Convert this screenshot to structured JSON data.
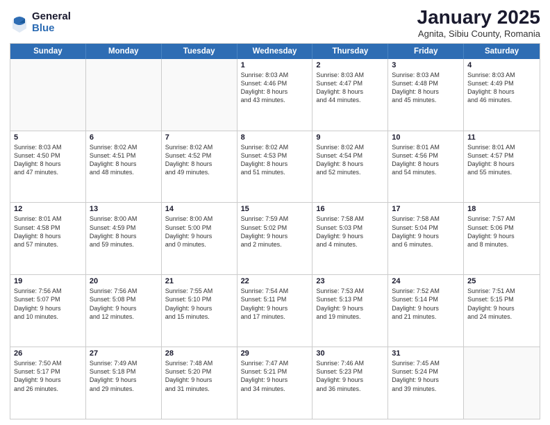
{
  "logo": {
    "general": "General",
    "blue": "Blue"
  },
  "title": "January 2025",
  "subtitle": "Agnita, Sibiu County, Romania",
  "days_of_week": [
    "Sunday",
    "Monday",
    "Tuesday",
    "Wednesday",
    "Thursday",
    "Friday",
    "Saturday"
  ],
  "weeks": [
    [
      {
        "day": "",
        "info": ""
      },
      {
        "day": "",
        "info": ""
      },
      {
        "day": "",
        "info": ""
      },
      {
        "day": "1",
        "info": "Sunrise: 8:03 AM\nSunset: 4:46 PM\nDaylight: 8 hours\nand 43 minutes."
      },
      {
        "day": "2",
        "info": "Sunrise: 8:03 AM\nSunset: 4:47 PM\nDaylight: 8 hours\nand 44 minutes."
      },
      {
        "day": "3",
        "info": "Sunrise: 8:03 AM\nSunset: 4:48 PM\nDaylight: 8 hours\nand 45 minutes."
      },
      {
        "day": "4",
        "info": "Sunrise: 8:03 AM\nSunset: 4:49 PM\nDaylight: 8 hours\nand 46 minutes."
      }
    ],
    [
      {
        "day": "5",
        "info": "Sunrise: 8:03 AM\nSunset: 4:50 PM\nDaylight: 8 hours\nand 47 minutes."
      },
      {
        "day": "6",
        "info": "Sunrise: 8:02 AM\nSunset: 4:51 PM\nDaylight: 8 hours\nand 48 minutes."
      },
      {
        "day": "7",
        "info": "Sunrise: 8:02 AM\nSunset: 4:52 PM\nDaylight: 8 hours\nand 49 minutes."
      },
      {
        "day": "8",
        "info": "Sunrise: 8:02 AM\nSunset: 4:53 PM\nDaylight: 8 hours\nand 51 minutes."
      },
      {
        "day": "9",
        "info": "Sunrise: 8:02 AM\nSunset: 4:54 PM\nDaylight: 8 hours\nand 52 minutes."
      },
      {
        "day": "10",
        "info": "Sunrise: 8:01 AM\nSunset: 4:56 PM\nDaylight: 8 hours\nand 54 minutes."
      },
      {
        "day": "11",
        "info": "Sunrise: 8:01 AM\nSunset: 4:57 PM\nDaylight: 8 hours\nand 55 minutes."
      }
    ],
    [
      {
        "day": "12",
        "info": "Sunrise: 8:01 AM\nSunset: 4:58 PM\nDaylight: 8 hours\nand 57 minutes."
      },
      {
        "day": "13",
        "info": "Sunrise: 8:00 AM\nSunset: 4:59 PM\nDaylight: 8 hours\nand 59 minutes."
      },
      {
        "day": "14",
        "info": "Sunrise: 8:00 AM\nSunset: 5:00 PM\nDaylight: 9 hours\nand 0 minutes."
      },
      {
        "day": "15",
        "info": "Sunrise: 7:59 AM\nSunset: 5:02 PM\nDaylight: 9 hours\nand 2 minutes."
      },
      {
        "day": "16",
        "info": "Sunrise: 7:58 AM\nSunset: 5:03 PM\nDaylight: 9 hours\nand 4 minutes."
      },
      {
        "day": "17",
        "info": "Sunrise: 7:58 AM\nSunset: 5:04 PM\nDaylight: 9 hours\nand 6 minutes."
      },
      {
        "day": "18",
        "info": "Sunrise: 7:57 AM\nSunset: 5:06 PM\nDaylight: 9 hours\nand 8 minutes."
      }
    ],
    [
      {
        "day": "19",
        "info": "Sunrise: 7:56 AM\nSunset: 5:07 PM\nDaylight: 9 hours\nand 10 minutes."
      },
      {
        "day": "20",
        "info": "Sunrise: 7:56 AM\nSunset: 5:08 PM\nDaylight: 9 hours\nand 12 minutes."
      },
      {
        "day": "21",
        "info": "Sunrise: 7:55 AM\nSunset: 5:10 PM\nDaylight: 9 hours\nand 15 minutes."
      },
      {
        "day": "22",
        "info": "Sunrise: 7:54 AM\nSunset: 5:11 PM\nDaylight: 9 hours\nand 17 minutes."
      },
      {
        "day": "23",
        "info": "Sunrise: 7:53 AM\nSunset: 5:13 PM\nDaylight: 9 hours\nand 19 minutes."
      },
      {
        "day": "24",
        "info": "Sunrise: 7:52 AM\nSunset: 5:14 PM\nDaylight: 9 hours\nand 21 minutes."
      },
      {
        "day": "25",
        "info": "Sunrise: 7:51 AM\nSunset: 5:15 PM\nDaylight: 9 hours\nand 24 minutes."
      }
    ],
    [
      {
        "day": "26",
        "info": "Sunrise: 7:50 AM\nSunset: 5:17 PM\nDaylight: 9 hours\nand 26 minutes."
      },
      {
        "day": "27",
        "info": "Sunrise: 7:49 AM\nSunset: 5:18 PM\nDaylight: 9 hours\nand 29 minutes."
      },
      {
        "day": "28",
        "info": "Sunrise: 7:48 AM\nSunset: 5:20 PM\nDaylight: 9 hours\nand 31 minutes."
      },
      {
        "day": "29",
        "info": "Sunrise: 7:47 AM\nSunset: 5:21 PM\nDaylight: 9 hours\nand 34 minutes."
      },
      {
        "day": "30",
        "info": "Sunrise: 7:46 AM\nSunset: 5:23 PM\nDaylight: 9 hours\nand 36 minutes."
      },
      {
        "day": "31",
        "info": "Sunrise: 7:45 AM\nSunset: 5:24 PM\nDaylight: 9 hours\nand 39 minutes."
      },
      {
        "day": "",
        "info": ""
      }
    ]
  ]
}
